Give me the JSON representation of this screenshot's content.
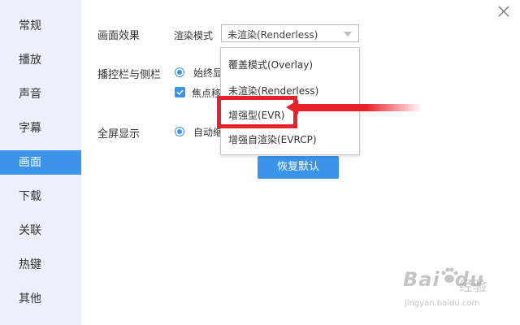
{
  "sidebar": {
    "items": [
      {
        "label": "常规"
      },
      {
        "label": "播放"
      },
      {
        "label": "声音"
      },
      {
        "label": "字幕"
      },
      {
        "label": "画面"
      },
      {
        "label": "下载"
      },
      {
        "label": "关联"
      },
      {
        "label": "热键"
      },
      {
        "label": "其他"
      }
    ],
    "active": "画面"
  },
  "main": {
    "picture_effect": {
      "section_label": "画面效果",
      "render_mode_label": "渲染模式",
      "render_mode_value": "未渲染(Renderless)"
    },
    "controls": {
      "section_label": "播控栏与侧栏",
      "option_always_show": "始终显",
      "option_focus": "焦点移"
    },
    "fullscreen": {
      "section_label": "全屏显示",
      "option_auto": "自动缩"
    },
    "restore_button": "恢复默认"
  },
  "dropdown": {
    "options": [
      {
        "label": "覆盖模式(Overlay)"
      },
      {
        "label": "未渲染(Renderless)"
      },
      {
        "label": "增强型(EVR)"
      },
      {
        "label": "增强自渲染(EVRCP)"
      }
    ],
    "highlighted": "增强型(EVR)"
  },
  "watermark": {
    "logo": "Bai",
    "logo_suffix": "du",
    "cn": "经验",
    "url": "jingyan.baidu.com"
  },
  "colors": {
    "accent": "#3b93ea",
    "sidebar_bg": "#eaf1fb",
    "annotation_red": "#e8222a"
  }
}
